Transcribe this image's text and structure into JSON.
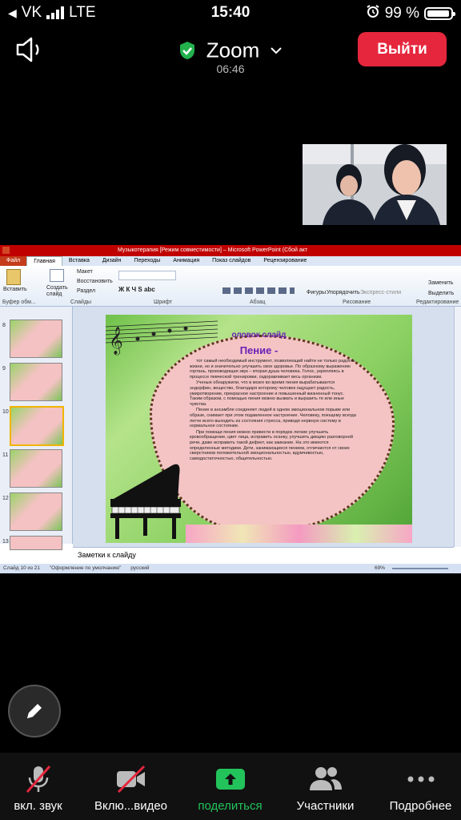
{
  "status_bar": {
    "carrier": "VK",
    "network": "LTE",
    "time": "15:40",
    "battery": "99 %"
  },
  "meeting": {
    "app_name": "Zoom",
    "duration": "06:46",
    "leave_label": "Выйти",
    "secure_color": "#23b14d"
  },
  "shared_screen": {
    "window_title": "Музыкотерапия [Режим совместимости] – Microsoft PowerPoint (Сбой акт",
    "file_tab": "Файл",
    "ribbon_tabs": [
      "Главная",
      "Вставка",
      "Дизайн",
      "Переходы",
      "Анимация",
      "Показ слайдов",
      "Рецензирование"
    ],
    "ribbon_groups": [
      "Буфер обм...",
      "Слайды",
      "Шрифт",
      "Абзац",
      "Рисование",
      "Редактирование"
    ],
    "ribbon_buttons": {
      "paste": "Вставить",
      "new_slide": "Создать слайд",
      "layout": "Макет",
      "reset": "Восстановить",
      "section": "Раздел",
      "shapes": "Фигуры",
      "arrange": "Упорядочить",
      "quick_styles": "Экспресс-стили",
      "replace": "Заменить",
      "select": "Выделить"
    },
    "thumbnail_numbers": [
      "8",
      "9",
      "10",
      "11",
      "12",
      "13"
    ],
    "selected_slide": "10",
    "slide": {
      "heading": "оловок слайд",
      "title": "Пение -",
      "paragraphs": [
        "тот самый необходимый инструмент, позволяющий найти не только радость жизни, но и значительно улучшить свое здоровье. По образному выражению гортань, производящая звук – вторая душа человека. Голос, укрепляясь в процессе певческой тренировки, оздоравливает весь организм.",
        "Ученые обнаружили, что в мозге во время пения вырабатываются эндорфин, вещество, благодаря которому человек ощущает радость, умиротворение, прекрасное настроение и повышенный жизненный тонус. Таким образом, с помощью пения можно вызвать и выразить те или иные чувства.",
        "Пение в ансамбле соединяет людей в одном эмоциональном порыве или образе, снимает при этом подавленное настроение. Человеку, поющему всегда легче всего выходить из состояния стресса, приводя нервную систему в нормальное состояние.",
        "При помощи пения можно привести в порядок легкие улучшить кровообращение, цвет лица, исправить осанку, улучшить дикцию разговорной речи, даже исправить такой дефект, как заикание. На это имеются определенные методики. Дети, занимающиеся пением, отличаются от своих сверстников положительной эмоциональностью, вдумчивостью, самодостаточностью, общительностью."
      ]
    },
    "notes_placeholder": "Заметки к слайду",
    "status_slide": "Слайд 10 из 21",
    "status_theme": "\"Оформление по умолчанию\"",
    "status_lang": "русский",
    "zoom_level": "69%"
  },
  "toolbar": {
    "items": [
      {
        "label": "вкл. звук",
        "icon": "mic-off-icon"
      },
      {
        "label": "Вклю...видео",
        "icon": "video-off-icon"
      },
      {
        "label": "поделиться",
        "icon": "share-icon"
      },
      {
        "label": "Участники",
        "icon": "participants-icon"
      },
      {
        "label": "Подробнее",
        "icon": "more-icon"
      }
    ],
    "share_color": "#23c35b",
    "mute_color": "#e5263d"
  }
}
